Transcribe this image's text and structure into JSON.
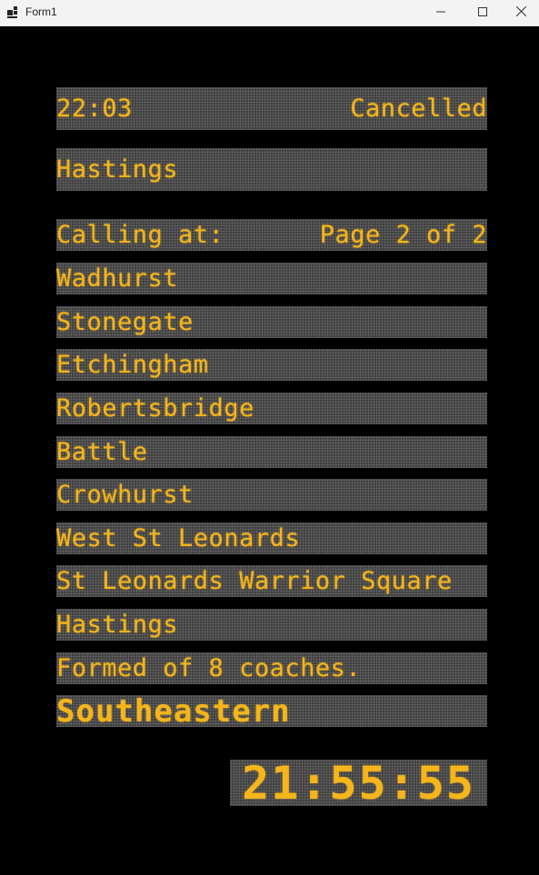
{
  "window": {
    "title": "Form1",
    "buttons": {
      "minimize": "minimize-icon",
      "maximize": "maximize-icon",
      "close": "close-icon"
    }
  },
  "colors": {
    "led": "#f5b51b",
    "board_bg": "#000000",
    "matrix": "#3b3b3b"
  },
  "departure": {
    "time": "22:03",
    "status": "Cancelled",
    "destination": "Hastings",
    "calling_label": "Calling at:",
    "page": "Page 2 of 2",
    "stops": [
      "Wadhurst",
      "Stonegate",
      "Etchingham",
      "Robertsbridge",
      "Battle",
      "Crowhurst",
      "West St Leonards",
      "St Leonards Warrior Square",
      "Hastings"
    ],
    "formation": "Formed of 8 coaches.",
    "operator": "Southeastern"
  },
  "clock": "21:55:55"
}
